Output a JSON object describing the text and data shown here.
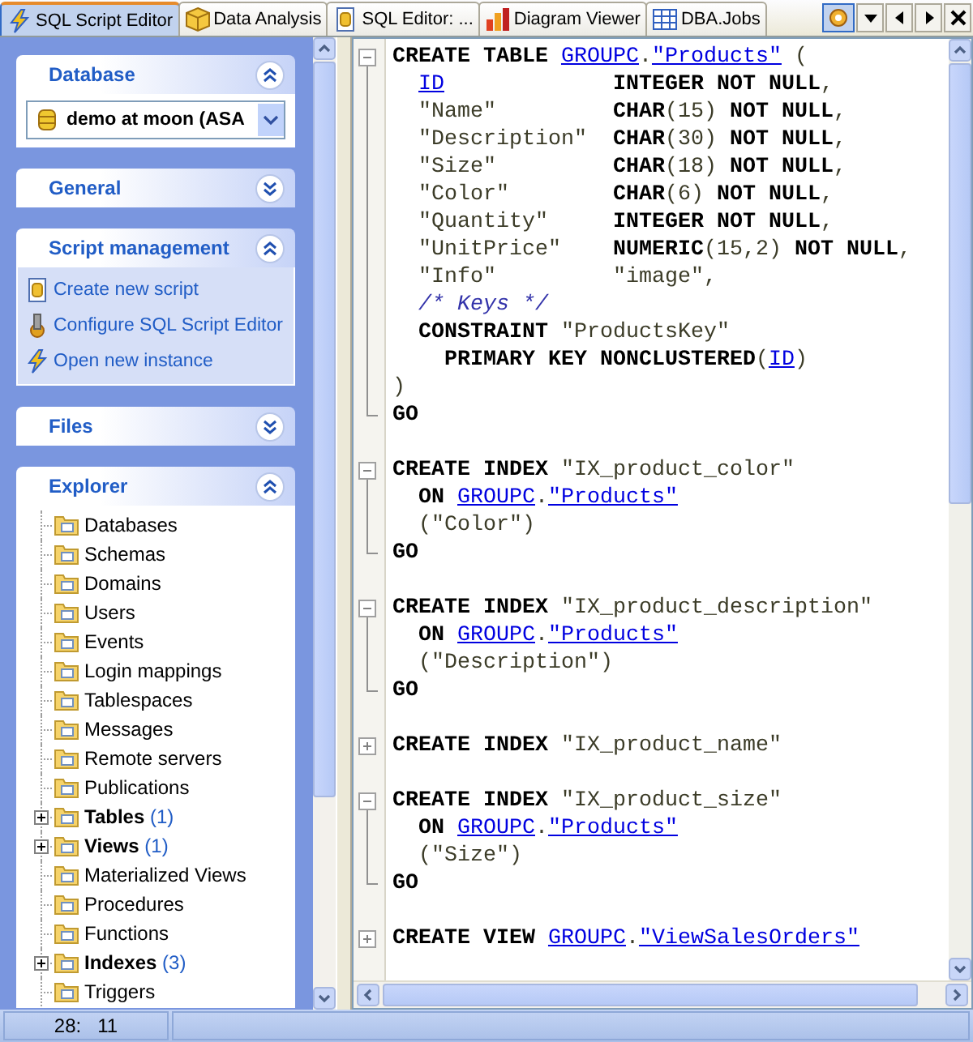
{
  "tabs": [
    {
      "label": "SQL Script Editor",
      "selected": true
    },
    {
      "label": "Data Analysis",
      "selected": false
    },
    {
      "label": "SQL Editor: ...",
      "selected": false
    },
    {
      "label": "Diagram Viewer",
      "selected": false
    },
    {
      "label": "DBA.Jobs",
      "selected": false
    }
  ],
  "sidebar": {
    "panels": [
      {
        "kind": "database",
        "title": "Database",
        "expanded": true,
        "database": "demo at moon (ASA"
      },
      {
        "title": "General",
        "expanded": false
      },
      {
        "kind": "links",
        "title": "Script management",
        "expanded": true,
        "items": [
          "Create new script",
          "Configure SQL Script Editor",
          "Open new instance"
        ]
      },
      {
        "title": "Files",
        "expanded": false
      },
      {
        "kind": "tree",
        "title": "Explorer",
        "expanded": true,
        "items": [
          {
            "label": "Databases",
            "bold": false,
            "has_children": false
          },
          {
            "label": "Schemas",
            "bold": false,
            "has_children": false
          },
          {
            "label": "Domains",
            "bold": false,
            "has_children": false
          },
          {
            "label": "Users",
            "bold": false,
            "has_children": false
          },
          {
            "label": "Events",
            "bold": false,
            "has_children": false
          },
          {
            "label": "Login mappings",
            "bold": false,
            "has_children": false
          },
          {
            "label": "Tablespaces",
            "bold": false,
            "has_children": false
          },
          {
            "label": "Messages",
            "bold": false,
            "has_children": false
          },
          {
            "label": "Remote servers",
            "bold": false,
            "has_children": false
          },
          {
            "label": "Publications",
            "bold": false,
            "has_children": false
          },
          {
            "label": "Tables",
            "count": "(1)",
            "bold": true,
            "has_children": true
          },
          {
            "label": "Views",
            "count": "(1)",
            "bold": true,
            "has_children": true
          },
          {
            "label": "Materialized Views",
            "bold": false,
            "has_children": false
          },
          {
            "label": "Procedures",
            "bold": false,
            "has_children": false
          },
          {
            "label": "Functions",
            "bold": false,
            "has_children": false
          },
          {
            "label": "Indexes",
            "count": "(3)",
            "bold": true,
            "has_children": true
          },
          {
            "label": "Triggers",
            "bold": false,
            "has_children": false
          }
        ]
      }
    ]
  },
  "editor": {
    "blocks": [
      {
        "expanded": true,
        "lines": [
          [
            {
              "kind": "keyword",
              "text": "CREATE TABLE "
            },
            {
              "kind": "link",
              "text": "GROUPC"
            },
            {
              "kind": "text",
              "text": "."
            },
            {
              "kind": "link",
              "text": "\"Products\""
            },
            {
              "kind": "text",
              "text": " ("
            }
          ],
          [
            {
              "kind": "link",
              "text": "  ID"
            },
            {
              "kind": "keyword",
              "text": "             INTEGER NOT NULL"
            },
            {
              "kind": "text",
              "text": ","
            }
          ],
          [
            {
              "kind": "text",
              "text": "  \"Name\"         "
            },
            {
              "kind": "keyword",
              "text": "CHAR"
            },
            {
              "kind": "text",
              "text": "(15) "
            },
            {
              "kind": "keyword",
              "text": "NOT NULL"
            },
            {
              "kind": "text",
              "text": ","
            }
          ],
          [
            {
              "kind": "text",
              "text": "  \"Description\"  "
            },
            {
              "kind": "keyword",
              "text": "CHAR"
            },
            {
              "kind": "text",
              "text": "(30) "
            },
            {
              "kind": "keyword",
              "text": "NOT NULL"
            },
            {
              "kind": "text",
              "text": ","
            }
          ],
          [
            {
              "kind": "text",
              "text": "  \"Size\"         "
            },
            {
              "kind": "keyword",
              "text": "CHAR"
            },
            {
              "kind": "text",
              "text": "(18) "
            },
            {
              "kind": "keyword",
              "text": "NOT NULL"
            },
            {
              "kind": "text",
              "text": ","
            }
          ],
          [
            {
              "kind": "text",
              "text": "  \"Color\"        "
            },
            {
              "kind": "keyword",
              "text": "CHAR"
            },
            {
              "kind": "text",
              "text": "(6) "
            },
            {
              "kind": "keyword",
              "text": "NOT NULL"
            },
            {
              "kind": "text",
              "text": ","
            }
          ],
          [
            {
              "kind": "text",
              "text": "  \"Quantity\"     "
            },
            {
              "kind": "keyword",
              "text": "INTEGER NOT NULL"
            },
            {
              "kind": "text",
              "text": ","
            }
          ],
          [
            {
              "kind": "text",
              "text": "  \"UnitPrice\"    "
            },
            {
              "kind": "keyword",
              "text": "NUMERIC"
            },
            {
              "kind": "text",
              "text": "(15,2) "
            },
            {
              "kind": "keyword",
              "text": "NOT NULL"
            },
            {
              "kind": "text",
              "text": ","
            }
          ],
          [
            {
              "kind": "text",
              "text": "  \"Info\"         \"image\","
            }
          ],
          [
            {
              "kind": "comment",
              "text": "  /* Keys */"
            }
          ],
          [
            {
              "kind": "keyword",
              "text": "  CONSTRAINT"
            },
            {
              "kind": "text",
              "text": " \"ProductsKey\""
            }
          ],
          [
            {
              "kind": "keyword",
              "text": "    PRIMARY KEY NONCLUSTERED"
            },
            {
              "kind": "text",
              "text": "("
            },
            {
              "kind": "link",
              "text": "ID"
            },
            {
              "kind": "text",
              "text": ")"
            }
          ],
          [
            {
              "kind": "text",
              "text": ")"
            }
          ],
          [
            {
              "kind": "keyword",
              "text": "GO"
            }
          ]
        ]
      },
      {
        "expanded": true,
        "lines": [
          [
            {
              "kind": "keyword",
              "text": "CREATE INDEX "
            },
            {
              "kind": "text",
              "text": "\"IX_product_color\""
            }
          ],
          [
            {
              "kind": "keyword",
              "text": "  ON "
            },
            {
              "kind": "link",
              "text": "GROUPC"
            },
            {
              "kind": "text",
              "text": "."
            },
            {
              "kind": "link",
              "text": "\"Products\""
            }
          ],
          [
            {
              "kind": "text",
              "text": "  (\"Color\")"
            }
          ],
          [
            {
              "kind": "keyword",
              "text": "GO"
            }
          ]
        ]
      },
      {
        "expanded": true,
        "lines": [
          [
            {
              "kind": "keyword",
              "text": "CREATE INDEX "
            },
            {
              "kind": "text",
              "text": "\"IX_product_description\""
            }
          ],
          [
            {
              "kind": "keyword",
              "text": "  ON "
            },
            {
              "kind": "link",
              "text": "GROUPC"
            },
            {
              "kind": "text",
              "text": "."
            },
            {
              "kind": "link",
              "text": "\"Products\""
            }
          ],
          [
            {
              "kind": "text",
              "text": "  (\"Description\")"
            }
          ],
          [
            {
              "kind": "keyword",
              "text": "GO"
            }
          ]
        ]
      },
      {
        "expanded": false,
        "lines": [
          [
            {
              "kind": "keyword",
              "text": "CREATE INDEX "
            },
            {
              "kind": "text",
              "text": "\"IX_product_name\""
            }
          ]
        ]
      },
      {
        "expanded": true,
        "lines": [
          [
            {
              "kind": "keyword",
              "text": "CREATE INDEX "
            },
            {
              "kind": "text",
              "text": "\"IX_product_size\""
            }
          ],
          [
            {
              "kind": "keyword",
              "text": "  ON "
            },
            {
              "kind": "link",
              "text": "GROUPC"
            },
            {
              "kind": "text",
              "text": "."
            },
            {
              "kind": "link",
              "text": "\"Products\""
            }
          ],
          [
            {
              "kind": "text",
              "text": "  (\"Size\")"
            }
          ],
          [
            {
              "kind": "keyword",
              "text": "GO"
            }
          ]
        ]
      },
      {
        "expanded": false,
        "lines": [
          [
            {
              "kind": "keyword",
              "text": "CREATE VIEW "
            },
            {
              "kind": "link",
              "text": "GROUPC"
            },
            {
              "kind": "text",
              "text": "."
            },
            {
              "kind": "link",
              "text": "\"ViewSalesOrders\""
            }
          ]
        ]
      }
    ]
  },
  "status_bar": {
    "position": "28:   11"
  }
}
